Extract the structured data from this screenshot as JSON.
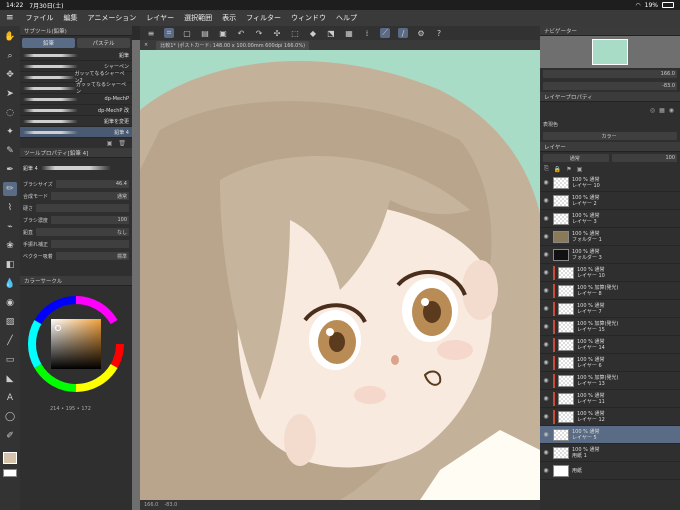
{
  "status": {
    "time": "14:22",
    "date": "7月30日(土)",
    "battery": "19%"
  },
  "menu": [
    "ファイル",
    "編集",
    "アニメーション",
    "レイヤー",
    "選択範囲",
    "表示",
    "フィルター",
    "ウィンドウ",
    "ヘルプ"
  ],
  "document": {
    "tab_label": "比較1* (ポストカード: 148.00 x 100.00mm 600dpi 166.0%)",
    "zoom_text": "166.0",
    "angle_text": "-83.0"
  },
  "left_panel": {
    "subtool_header": "サブツール(鉛筆)",
    "subtabs": [
      "鉛筆",
      "パステル"
    ],
    "brushes": [
      {
        "name": "鉛筆"
      },
      {
        "name": "シャーペン"
      },
      {
        "name": "ガッッてなるシャーペン2"
      },
      {
        "name": "ガッッてなるシャーペン"
      },
      {
        "name": "dp-MechP"
      },
      {
        "name": "dp-MechP 改"
      },
      {
        "name": "鉛筆を変更"
      },
      {
        "name": "鉛筆 4"
      }
    ],
    "tool_property_header": "ツールプロパティ[鉛筆 4]",
    "tool_property_title": "鉛筆 4",
    "props": [
      {
        "label": "ブラシサイズ",
        "value": "46.4"
      },
      {
        "label": "合成モード",
        "value": "通常"
      },
      {
        "label": "硬さ",
        "value": ""
      },
      {
        "label": "ブラシ濃度",
        "value": "100"
      },
      {
        "label": "鉛直",
        "value": "なし"
      },
      {
        "label": "手振れ補正",
        "value": ""
      },
      {
        "label": "ベクター吸着",
        "value": "標準"
      }
    ],
    "color_header": "カラーサークル",
    "color_values": "214 • 195 • 172",
    "accent": "#f2a23c"
  },
  "right_panel": {
    "navigator_header": "ナビゲーター",
    "nav_zoom": "166.0",
    "nav_angle": "-83.0",
    "layer_property_header": "レイヤープロパティ",
    "effect_label": "表現色",
    "effect_value": "カラー",
    "layer_panel_header": "レイヤー",
    "blend_mode": "通常",
    "opacity": "100",
    "layers": [
      {
        "percent": "100 % 通常",
        "name": "レイヤー 10",
        "clip": false,
        "sel": false,
        "type": "layer"
      },
      {
        "percent": "100 % 通常",
        "name": "レイヤー 2",
        "clip": false,
        "sel": false,
        "type": "layer"
      },
      {
        "percent": "100 % 通常",
        "name": "レイヤー 3",
        "clip": false,
        "sel": false,
        "type": "layer"
      },
      {
        "percent": "100 % 通常",
        "name": "フォルダー 1",
        "clip": false,
        "sel": false,
        "type": "folder"
      },
      {
        "percent": "100 % 通常",
        "name": "フォルダー 3",
        "clip": false,
        "sel": false,
        "type": "mask"
      },
      {
        "percent": "100 % 通常",
        "name": "レイヤー 10",
        "clip": true,
        "sel": false,
        "type": "layer"
      },
      {
        "percent": "100 % 加算(発光)",
        "name": "レイヤー 8",
        "clip": true,
        "sel": false,
        "type": "layer"
      },
      {
        "percent": "100 % 通常",
        "name": "レイヤー 7",
        "clip": true,
        "sel": false,
        "type": "layer"
      },
      {
        "percent": "100 % 加算(発光)",
        "name": "レイヤー 15",
        "clip": true,
        "sel": false,
        "type": "layer"
      },
      {
        "percent": "100 % 通常",
        "name": "レイヤー 14",
        "clip": true,
        "sel": false,
        "type": "layer"
      },
      {
        "percent": "100 % 通常",
        "name": "レイヤー 6",
        "clip": true,
        "sel": false,
        "type": "layer"
      },
      {
        "percent": "100 % 加算(発光)",
        "name": "レイヤー 13",
        "clip": true,
        "sel": false,
        "type": "layer"
      },
      {
        "percent": "100 % 通常",
        "name": "レイヤー 11",
        "clip": true,
        "sel": false,
        "type": "layer"
      },
      {
        "percent": "100 % 通常",
        "name": "レイヤー 12",
        "clip": true,
        "sel": false,
        "type": "layer"
      },
      {
        "percent": "100 % 通常",
        "name": "レイヤー 5",
        "clip": false,
        "sel": true,
        "type": "layer"
      },
      {
        "percent": "100 % 通常",
        "name": "用紙 1",
        "clip": false,
        "sel": false,
        "type": "layer"
      },
      {
        "percent": "",
        "name": "用紙",
        "clip": false,
        "sel": false,
        "type": "paper"
      }
    ]
  }
}
